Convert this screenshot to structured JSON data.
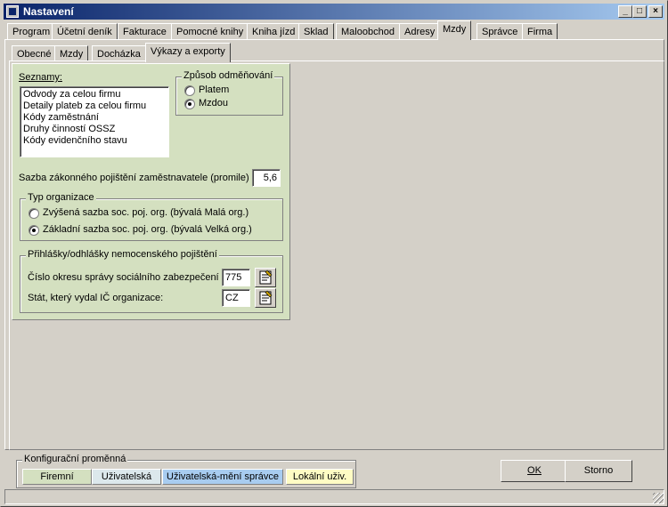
{
  "window": {
    "title": "Nastavení"
  },
  "main_tabs": [
    {
      "label": "Program"
    },
    {
      "label": "Účetní deník"
    },
    {
      "label": "Fakturace"
    },
    {
      "label": "Pomocné knihy"
    },
    {
      "label": "Kniha jízd"
    },
    {
      "label": "Sklad"
    },
    {
      "label": "Maloobchod"
    },
    {
      "label": "Adresy"
    },
    {
      "label": "Mzdy"
    },
    {
      "label": "Správce"
    },
    {
      "label": "Firma"
    }
  ],
  "active_main_tab": "Mzdy",
  "sub_tabs": [
    {
      "label": "Obecné"
    },
    {
      "label": "Mzdy"
    },
    {
      "label": "Docházka"
    },
    {
      "label": "Výkazy a exporty"
    }
  ],
  "active_sub_tab": "Výkazy a exporty",
  "seznamy": {
    "label": "Seznamy:",
    "items": [
      "Odvody za celou firmu",
      "Detaily plateb za celou firmu",
      "Kódy zaměstnání",
      "Druhy činností OSSZ",
      "Kódy evidenčního stavu"
    ]
  },
  "odmenovani": {
    "title": "Způsob odměňování",
    "options": [
      {
        "label": "Platem",
        "selected": false
      },
      {
        "label": "Mzdou",
        "selected": true
      }
    ]
  },
  "sazba": {
    "label": "Sazba zákonného pojištění zaměstnavatele (promile)",
    "value": "5,6"
  },
  "typ_organizace": {
    "title": "Typ organizace",
    "options": [
      {
        "label": "Zvýšená sazba soc. poj. org. (bývalá Malá org.)",
        "selected": false
      },
      {
        "label": "Základní sazba soc. poj. org. (bývalá Velká org.)",
        "selected": true
      }
    ]
  },
  "prihlasky": {
    "title": "Přihlášky/odhlášky nemocenského pojištění",
    "okres_label": "Číslo okresu správy sociálního zabezpečení",
    "okres_value": "775",
    "stat_label": "Stát, který  vydal IČ organizace:",
    "stat_value": "CZ"
  },
  "konfiguracni": {
    "title": "Konfigurační proměnná",
    "buttons": [
      {
        "label": "Firemní",
        "color": "#d4e0c0"
      },
      {
        "label": "Uživatelská",
        "color": "#dce8ec"
      },
      {
        "label": "Uživatelská-mění správce",
        "color": "#a8ccf0"
      },
      {
        "label": "Lokální uživ.",
        "color": "#fffcc4"
      }
    ]
  },
  "buttons": {
    "ok": "OK",
    "storno": "Storno"
  },
  "icons": [
    "app-icon",
    "minimize-icon",
    "maximize-icon",
    "close-icon",
    "picker-icon"
  ]
}
